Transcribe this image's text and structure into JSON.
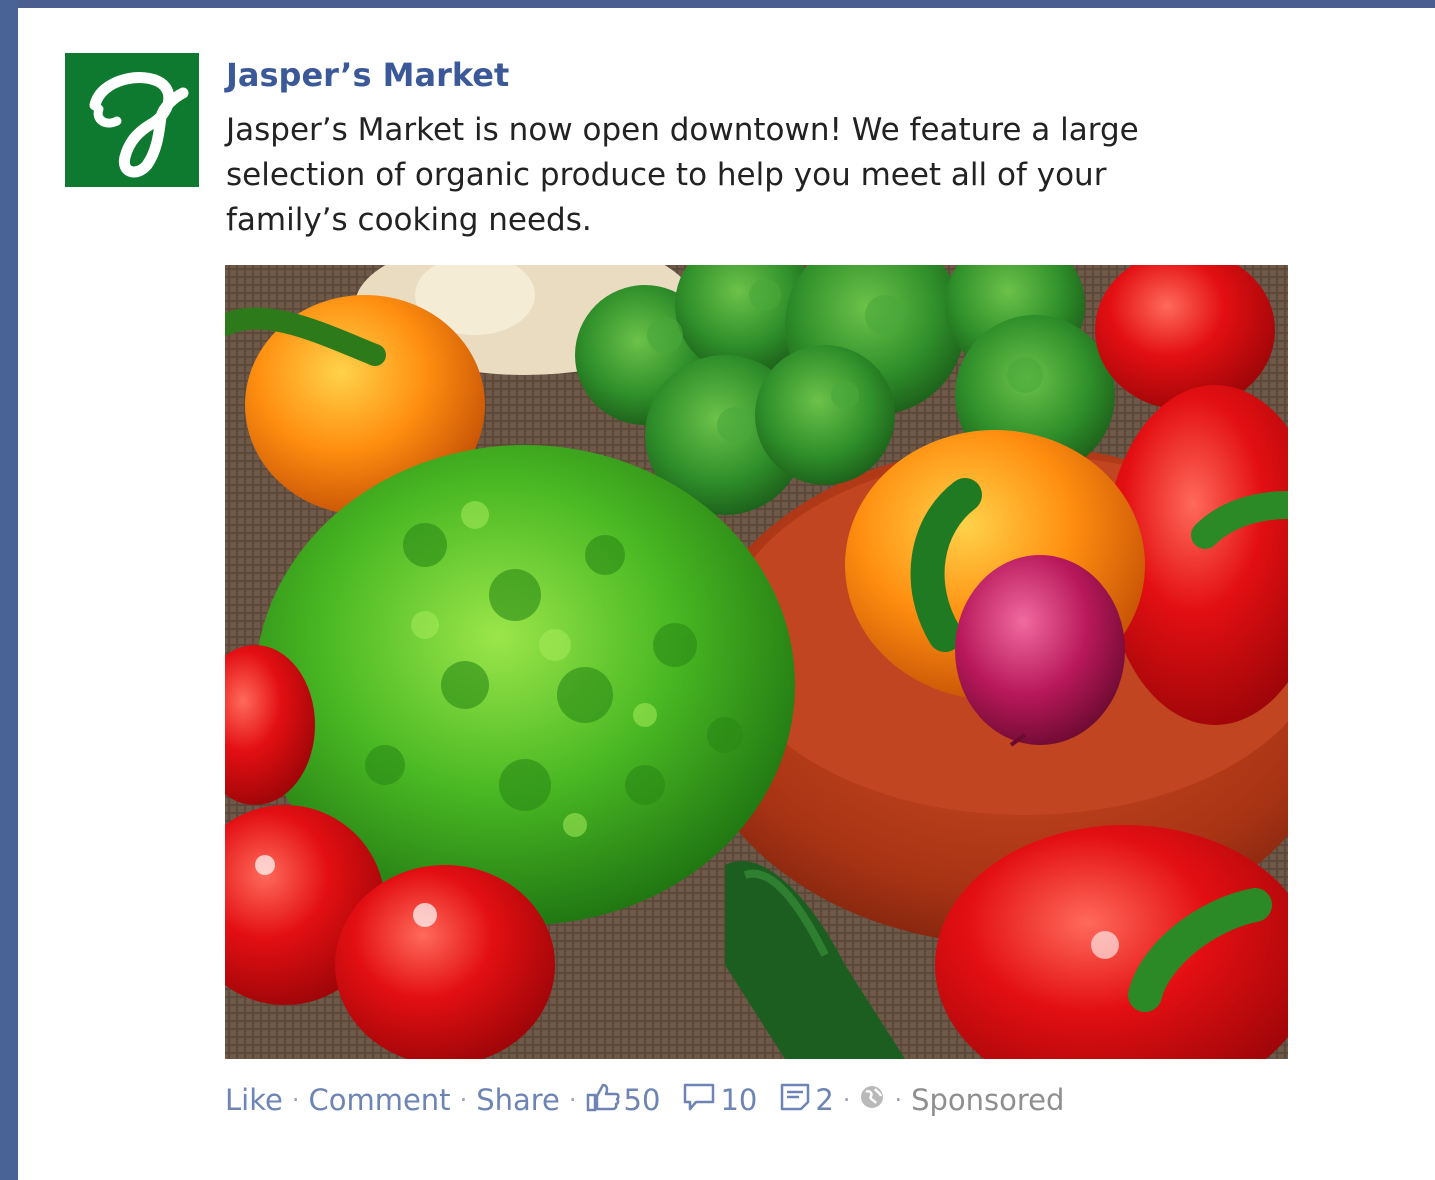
{
  "page": {
    "name": "Jasper’s Market",
    "logo_letter": "J",
    "logo_color": "#0e7a2f"
  },
  "post": {
    "text_lines": [
      "Jasper’s Market is now open downtown! We feature a large",
      "selection of organic produce to help you meet all of your",
      "family’s cooking needs."
    ],
    "image": "vegetables-photo"
  },
  "actions": {
    "like_label": "Like",
    "comment_label": "Comment",
    "share_label": "Share",
    "like_count": "50",
    "comment_count": "10",
    "share_count": "2",
    "sponsored_label": "Sponsored"
  },
  "colors": {
    "brand_blue": "#3b5998",
    "link_blue": "#6d84b4"
  }
}
